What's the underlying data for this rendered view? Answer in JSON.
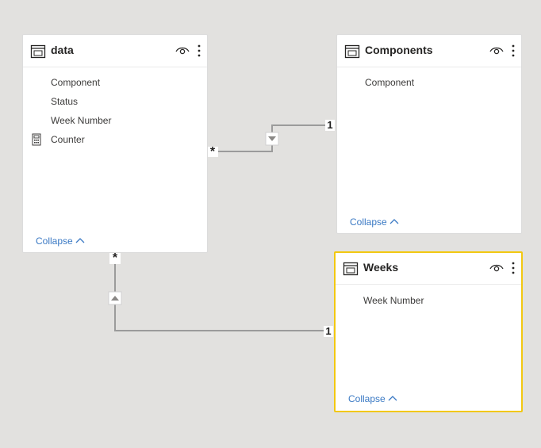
{
  "tables": [
    {
      "title": "data",
      "fields": [
        "Component",
        "Status",
        "Week Number",
        "Counter"
      ],
      "collapse_label": "Collapse"
    },
    {
      "title": "Components",
      "fields": [
        "Component"
      ],
      "collapse_label": "Collapse"
    },
    {
      "title": "Weeks",
      "fields": [
        "Week Number"
      ],
      "collapse_label": "Collapse",
      "selected": true
    }
  ],
  "relationships": [
    {
      "from": "data",
      "to": "Components",
      "from_cardinality": "*",
      "to_cardinality": "1",
      "direction": "single"
    },
    {
      "from": "data",
      "to": "Weeks",
      "from_cardinality": "*",
      "to_cardinality": "1",
      "direction": "single"
    }
  ],
  "icons": {
    "table": "table-icon",
    "visibility": "eye-icon",
    "more_options": "more-options-icon",
    "measure": "calculator-icon",
    "collapse": "chevron-up-icon",
    "filter_direction": "triangle-arrow-icon"
  },
  "colors": {
    "canvas": "#e2e1df",
    "card": "#ffffff",
    "selected_border": "#f2c811",
    "link": "#3a79c4",
    "relationship_line": "#999999"
  }
}
